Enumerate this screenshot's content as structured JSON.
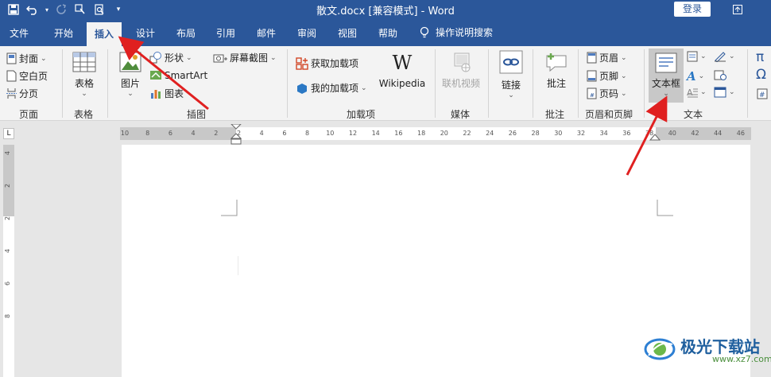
{
  "window": {
    "title": "散文.docx [兼容模式] - Word",
    "login": "登录"
  },
  "tabs": [
    "文件",
    "开始",
    "插入",
    "设计",
    "布局",
    "引用",
    "邮件",
    "审阅",
    "视图",
    "帮助"
  ],
  "active_tab": "插入",
  "tellme": "操作说明搜索",
  "ribbon": {
    "pages": {
      "cover": "封面",
      "blank": "空白页",
      "break": "分页",
      "label": "页面"
    },
    "table": {
      "btn": "表格",
      "label": "表格"
    },
    "illustrations": {
      "pictures": "图片",
      "shapes": "形状",
      "smartart": "SmartArt",
      "chart": "图表",
      "screenshot": "屏幕截图",
      "label": "插图"
    },
    "addins": {
      "get": "获取加载项",
      "my": "我的加载项",
      "wiki": "Wikipedia",
      "label": "加载项"
    },
    "media": {
      "video": "联机视频",
      "label": "媒体"
    },
    "links": {
      "link": "链接"
    },
    "comments": {
      "comment": "批注",
      "label": "批注"
    },
    "header_footer": {
      "header": "页眉",
      "footer": "页脚",
      "page_number": "页码",
      "label": "页眉和页脚"
    },
    "text": {
      "textbox": "文本框",
      "label": "文本"
    },
    "symbols": {
      "pi": "π",
      "omega": "Ω"
    }
  },
  "ruler": {
    "h_ticks": [
      "10",
      "8",
      "6",
      "4",
      "2",
      "2",
      "4",
      "6",
      "8",
      "10",
      "12",
      "14",
      "16",
      "18",
      "20",
      "22",
      "24",
      "26",
      "28",
      "30",
      "32",
      "34",
      "36",
      "38",
      "40",
      "42",
      "44",
      "46"
    ],
    "v_ticks": [
      "4",
      "2",
      "2",
      "4",
      "6",
      "8"
    ],
    "corner": "L"
  },
  "watermark": {
    "text": "极光下载站",
    "url": "www.xz7.com"
  },
  "colors": {
    "accent": "#2b579a",
    "annotation": "#e02020"
  }
}
